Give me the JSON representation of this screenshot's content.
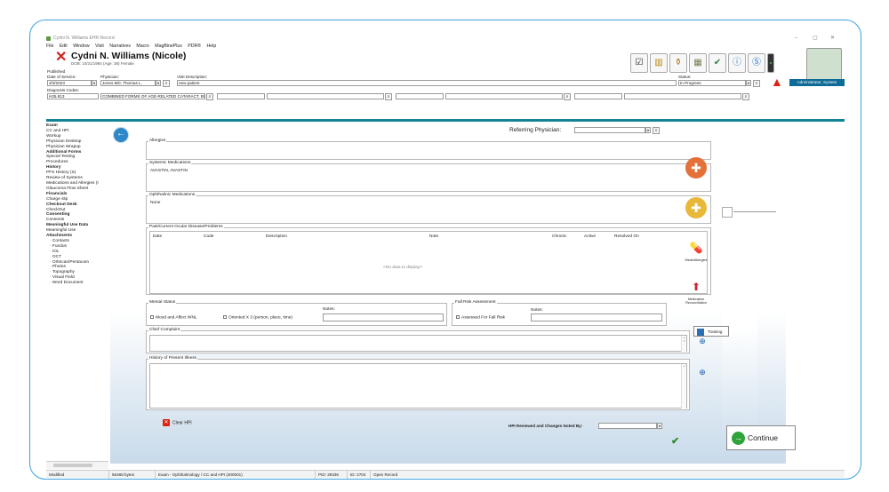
{
  "window": {
    "title": "Cydni N. Williams EHR Record",
    "controls": [
      "–",
      "▢",
      "✕"
    ]
  },
  "menu": [
    "File",
    "Edit",
    "Window",
    "Visit",
    "Narratives",
    "Macro",
    "MagBinePlus",
    "PDR®",
    "Help"
  ],
  "patient": {
    "name": "Cydni N. Williams (Nicole)",
    "dob": "DOB: 10/31/1984 (Age: 38) Female",
    "status_line": "Published"
  },
  "visit": {
    "date_label": "Date of Service:",
    "date": "3/3/2023",
    "physician_label": "Physician:",
    "physician": "Jones MD, Thomas L.",
    "desc_label": "Visit Description:",
    "desc": "new patient",
    "status_label": "Status:",
    "status": "In Progress",
    "dx_label": "Diagnosis Codes:",
    "dx_code": "H25.813",
    "dx_desc": "COMBINED FORMS OF AGE-RELATED CATARACT, BIL"
  },
  "user": {
    "role": "Administrator, System"
  },
  "left_nav": [
    {
      "label": "Exam",
      "bold": true
    },
    {
      "label": "CC and HPI"
    },
    {
      "label": "Workup"
    },
    {
      "label": "Physician Desktop"
    },
    {
      "label": "Physician Wrapup"
    },
    {
      "label": "Additional Forms",
      "bold": true
    },
    {
      "label": "Special Testing"
    },
    {
      "label": "Procedures"
    },
    {
      "label": "History",
      "bold": true
    },
    {
      "label": "PFS History (S)"
    },
    {
      "label": "Review of Systems"
    },
    {
      "label": "Medications and Allergies (I"
    },
    {
      "label": "Glaucoma Flow Sheet"
    },
    {
      "label": "Financials",
      "bold": true
    },
    {
      "label": "Charge slip"
    },
    {
      "label": "Checkout Desk",
      "bold": true
    },
    {
      "label": "CheckOut"
    },
    {
      "label": "Consenting",
      "bold": true
    },
    {
      "label": "Consents"
    },
    {
      "label": "Meaningful Use Data",
      "bold": true
    },
    {
      "label": "Meaningful Use"
    },
    {
      "label": "Attachments",
      "bold": true
    },
    {
      "label": "Contacts",
      "sub": true
    },
    {
      "label": "Fundus",
      "sub": true
    },
    {
      "label": "IOL",
      "sub": true
    },
    {
      "label": "OCT",
      "sub": true
    },
    {
      "label": "Orbscan/Pentacam",
      "sub": true
    },
    {
      "label": "Photos",
      "sub": true
    },
    {
      "label": "Topography",
      "sub": true
    },
    {
      "label": "Visual Field",
      "sub": true
    },
    {
      "label": "Word Document",
      "sub": true
    }
  ],
  "referring": {
    "label": "Referring Physician:"
  },
  "sections": {
    "allergies": {
      "title": "Allergies"
    },
    "systemic": {
      "title": "Systemic Medications",
      "value": "AVASTIN,  AVASTIN"
    },
    "ophthalmic": {
      "title": "Ophthalmic Medications",
      "value": "None"
    },
    "ocular": {
      "title": "Past/Current Ocular Disease/Problems",
      "columns": [
        "Date",
        "Code",
        "Description",
        "Note",
        "Chronic",
        "Active",
        "Resolved On"
      ],
      "empty": "<No data to display>"
    },
    "mental": {
      "title": "Mental Status",
      "opt1": "Mood and Affect WNL",
      "opt2": "Oriented X 3 (person, place, time)",
      "notes": "Notes:"
    },
    "fall": {
      "title": "Fall Risk Assessment",
      "opt1": "Assessed For Fall Risk",
      "notes": "Notes:"
    },
    "cc": {
      "title": "Chief Complaint"
    },
    "hpi": {
      "title": "History of Present Illness"
    }
  },
  "right_buttons": {
    "meds": "Meds/Allergies",
    "recon1": "Medication",
    "recon2": "Reconciliation",
    "training": "Training"
  },
  "actions": {
    "clear_hpi": "Clear HPI",
    "hpi_reviewed": "HPI Reviewed and Changes Noted By:",
    "continue": "Continue"
  },
  "statusbar": {
    "state": "Modified",
    "size": "56488 bytes",
    "form": "Exam - Ophthalmology / CC and HPI (400001)",
    "pid": "PID: 29336",
    "id": "ID: 2704",
    "record": "Open Record"
  },
  "colors": {
    "accent": "#128296",
    "frame": "#3aa2dc",
    "admin": "#0e6a96"
  }
}
